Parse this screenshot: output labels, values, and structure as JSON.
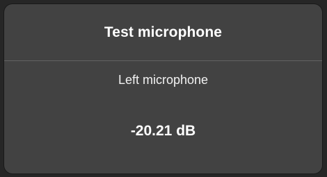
{
  "dialog": {
    "title": "Test microphone",
    "microphone_label": "Left microphone",
    "level_readout": "-20.21 dB"
  }
}
